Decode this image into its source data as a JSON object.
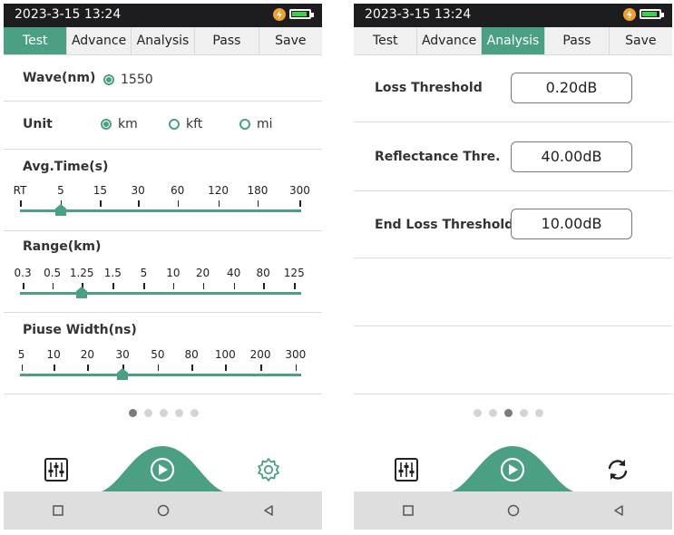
{
  "left": {
    "status": {
      "time": "2023-3-15 13:24"
    },
    "tabs": [
      "Test",
      "Advance",
      "Analysis",
      "Pass",
      "Save"
    ],
    "active_tab": "Test",
    "wave": {
      "label": "Wave(nm)",
      "option": "1550"
    },
    "unit": {
      "label": "Unit",
      "options": [
        "km",
        "kft",
        "mi"
      ],
      "selected": "km"
    },
    "avg_time": {
      "label": "Avg.Time(s)",
      "ticks": [
        "RT",
        "5",
        "15",
        "30",
        "60",
        "120",
        "180",
        "300"
      ],
      "selected": "5"
    },
    "range": {
      "label": "Range(km)",
      "ticks": [
        "0.3",
        "0.5",
        "1.25",
        "1.5",
        "5",
        "10",
        "20",
        "40",
        "80",
        "125"
      ],
      "selected": "1.25"
    },
    "pulse_width": {
      "label": "Piuse Width(ns)",
      "ticks": [
        "5",
        "10",
        "20",
        "30",
        "50",
        "80",
        "100",
        "200",
        "300"
      ],
      "selected": "30"
    },
    "page_indicator": {
      "count": 5,
      "active": 1
    },
    "bottom": {
      "left_icon": "equalizer-icon",
      "center_icon": "play-icon",
      "right_icon": "gear-icon"
    }
  },
  "right": {
    "status": {
      "time": "2023-3-15 13:24"
    },
    "tabs": [
      "Test",
      "Advance",
      "Analysis",
      "Pass",
      "Save"
    ],
    "active_tab": "Analysis",
    "thresholds": [
      {
        "label": "Loss Threshold",
        "value": "0.20dB"
      },
      {
        "label": "Reflectance Thre.",
        "value": "40.00dB"
      },
      {
        "label": "End Loss Threshold",
        "value": "10.00dB"
      }
    ],
    "page_indicator": {
      "count": 5,
      "active": 3
    },
    "bottom": {
      "left_icon": "equalizer-icon",
      "center_icon": "play-icon",
      "right_icon": "refresh-icon"
    }
  },
  "nav_icons": [
    "square-icon",
    "circle-icon",
    "back-triangle-icon"
  ],
  "colors": {
    "accent": "#4b9f82",
    "statusbar": "#1d1d1f",
    "battery": "#3ecf4a",
    "bolt": "#f0a030"
  }
}
